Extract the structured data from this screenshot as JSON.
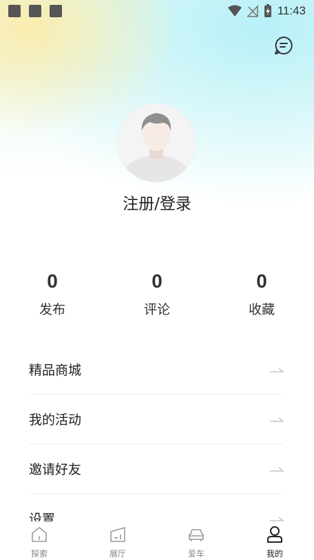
{
  "status_bar": {
    "time": "11:43",
    "left_icons": [
      "notification-square-icon",
      "notification-square-icon",
      "notification-square-icon"
    ],
    "right_icons": [
      "wifi-icon",
      "no-signal-icon",
      "battery-charging-icon"
    ]
  },
  "header": {
    "message_icon": "message-icon"
  },
  "profile": {
    "avatar_icon": "avatar-placeholder-icon",
    "login_label": "注册/登录"
  },
  "stats": [
    {
      "value": "0",
      "label": "发布"
    },
    {
      "value": "0",
      "label": "评论"
    },
    {
      "value": "0",
      "label": "收藏"
    }
  ],
  "menu": [
    {
      "label": "精品商城"
    },
    {
      "label": "我的活动"
    },
    {
      "label": "邀请好友"
    },
    {
      "label": "设置"
    }
  ],
  "tabs": [
    {
      "label": "探索",
      "icon": "home-icon",
      "active": false
    },
    {
      "label": "展厅",
      "icon": "showroom-icon",
      "active": false
    },
    {
      "label": "爱车",
      "icon": "car-icon",
      "active": false
    },
    {
      "label": "我的",
      "icon": "profile-icon",
      "active": true
    }
  ],
  "colors": {
    "text": "#222222",
    "muted": "#888888",
    "divider": "#eeeeee"
  }
}
